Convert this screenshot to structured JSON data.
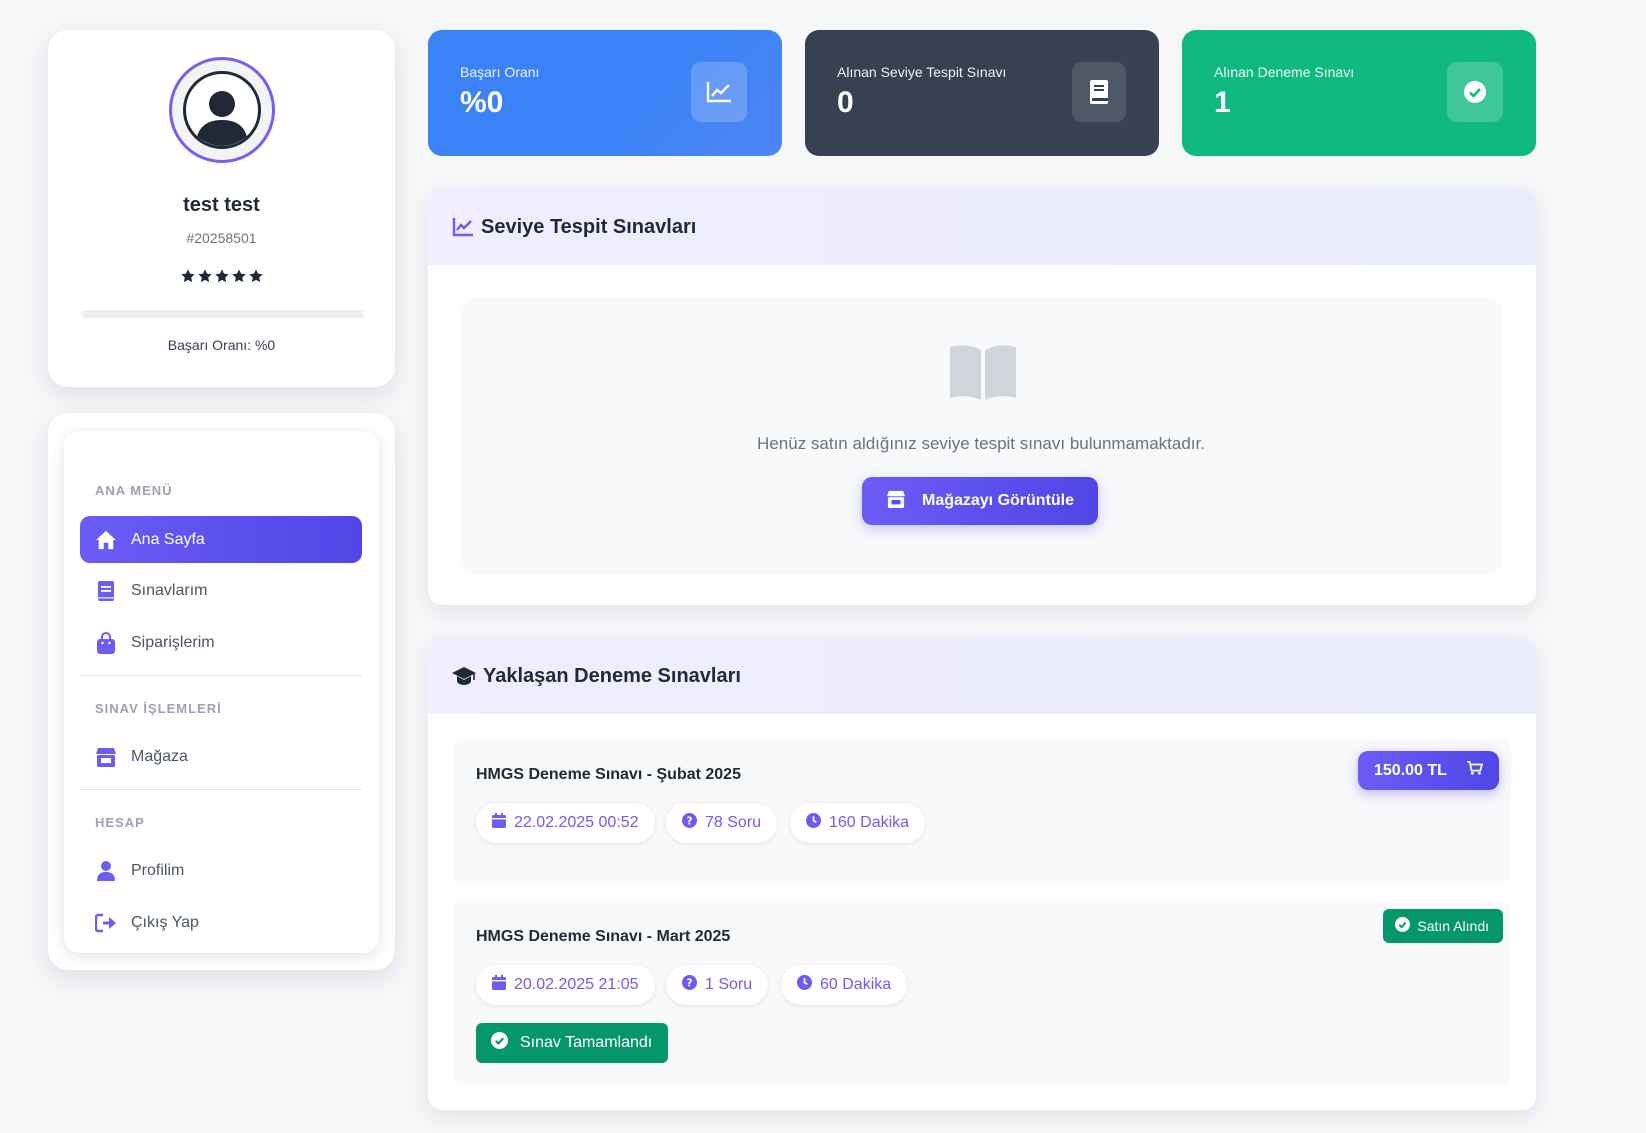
{
  "profile": {
    "name": "test test",
    "id": "#20258501",
    "stars": 5,
    "progress": 0,
    "success_text": "Başarı Oranı: %0"
  },
  "sidebar": {
    "sections": [
      {
        "title": "ANA MENÜ"
      },
      {
        "title": "SINAV İŞLEMLERİ"
      },
      {
        "title": "HESAP"
      }
    ],
    "items": [
      {
        "label": "Ana Sayfa",
        "icon": "home-icon",
        "active": true
      },
      {
        "label": "Sınavlarım",
        "icon": "book-icon"
      },
      {
        "label": "Siparişlerim",
        "icon": "shopping-bag-icon"
      },
      {
        "label": "Mağaza",
        "icon": "store-icon"
      },
      {
        "label": "Profilim",
        "icon": "user-icon"
      },
      {
        "label": "Çıkış Yap",
        "icon": "logout-icon"
      }
    ]
  },
  "stats": [
    {
      "label": "Başarı Oranı",
      "value": "%0",
      "icon": "chart-line-icon",
      "color": "#3b82f6"
    },
    {
      "label": "Alınan Seviye Tespit Sınavı",
      "value": "0",
      "icon": "book-icon",
      "color": "#374151"
    },
    {
      "label": "Alınan Deneme Sınavı",
      "value": "1",
      "icon": "check-circle-icon",
      "color": "#10b981"
    }
  ],
  "placement": {
    "title": "Seviye Tespit Sınavları",
    "empty_text": "Henüz satın aldığınız seviye tespit sınavı bulunmamaktadır.",
    "button": "Mağazayı Görüntüle"
  },
  "upcoming": {
    "title": "Yaklaşan Deneme Sınavları",
    "exams": [
      {
        "title": "HMGS Deneme Sınavı - Şubat 2025",
        "date": "22.02.2025 00:52",
        "questions": "78 Soru",
        "duration": "160 Dakika",
        "price": "150.00 TL"
      },
      {
        "title": "HMGS Deneme Sınavı - Mart 2025",
        "date": "20.02.2025 21:05",
        "questions": "1 Soru",
        "duration": "60 Dakika",
        "badge": "Satın Alındı",
        "status": "Sınav Tamamlandı"
      }
    ]
  },
  "colors": {
    "accent": "#6d5cf0",
    "success": "#059669"
  }
}
